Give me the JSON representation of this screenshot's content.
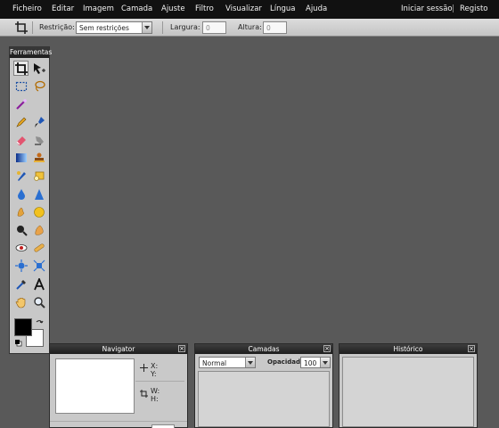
{
  "menubar": {
    "items": [
      "Ficheiro",
      "Editar",
      "Imagem",
      "Camada",
      "Ajuste",
      "Filtro",
      "Visualizar",
      "Língua",
      "Ajuda"
    ],
    "login": "Iniciar sessão",
    "separator": "|",
    "register": "Registo"
  },
  "options": {
    "restriction_label": "Restrição:",
    "restriction_value": "Sem restrições",
    "width_label": "Largura:",
    "width_value": "0",
    "height_label": "Altura:",
    "height_value": "0"
  },
  "tools": {
    "title": "Ferramentas",
    "foreground_color": "#000000",
    "background_color": "#ffffff"
  },
  "navigator": {
    "title": "Navigator",
    "x_label": "X:",
    "y_label": "Y:",
    "w_label": "W:",
    "h_label": "H:"
  },
  "layers": {
    "title": "Camadas",
    "blend_mode": "Normal",
    "opacity_label": "Opacidade:",
    "opacity_value": "100"
  },
  "history": {
    "title": "Histórico"
  }
}
